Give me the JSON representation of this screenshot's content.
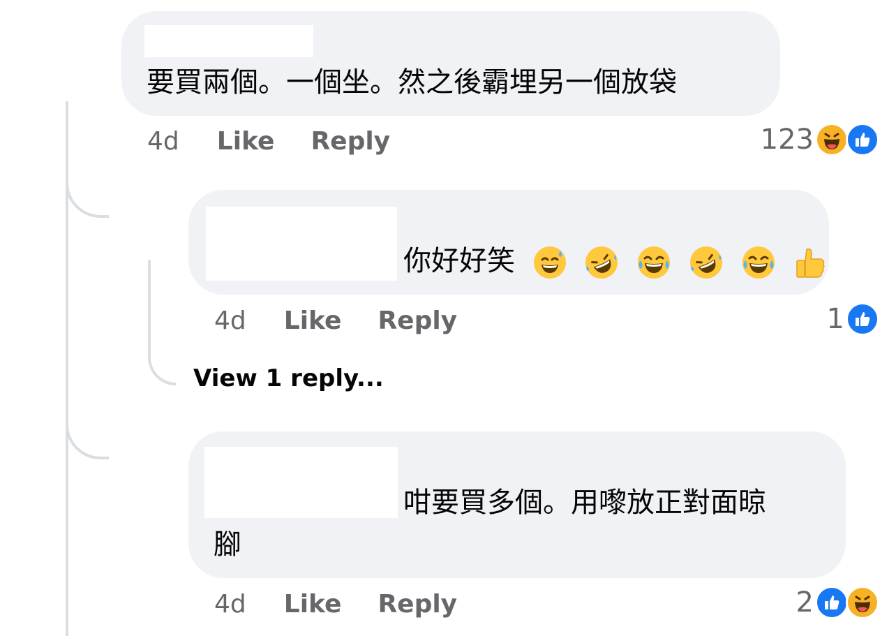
{
  "comments": [
    {
      "text": "要買兩個。一個坐。然之後霸埋另一個放袋",
      "time": "4d",
      "like_label": "Like",
      "reply_label": "Reply",
      "reaction_count": "123",
      "reactions": [
        "haha-icon",
        "like-icon"
      ]
    },
    {
      "text": "你好好笑",
      "emojis": [
        "sweat-smile-emoji",
        "rofl-emoji",
        "joy-emoji",
        "rofl-emoji",
        "joy-emoji",
        "thumbs-up-emoji"
      ],
      "time": "4d",
      "like_label": "Like",
      "reply_label": "Reply",
      "reaction_count": "1",
      "reactions": [
        "like-icon"
      ],
      "view_replies": "View 1 reply..."
    },
    {
      "text_line1": "咁要買多個。用嚟放正對面晾",
      "text_line2": "腳",
      "time": "4d",
      "like_label": "Like",
      "reply_label": "Reply",
      "reaction_count": "2",
      "reactions": [
        "like-icon",
        "haha-icon"
      ]
    }
  ],
  "colors": {
    "bubble": "#f0f2f5",
    "meta_text": "#65676b",
    "like_blue": "#1877f2",
    "haha_yellow": "#f7b125"
  }
}
